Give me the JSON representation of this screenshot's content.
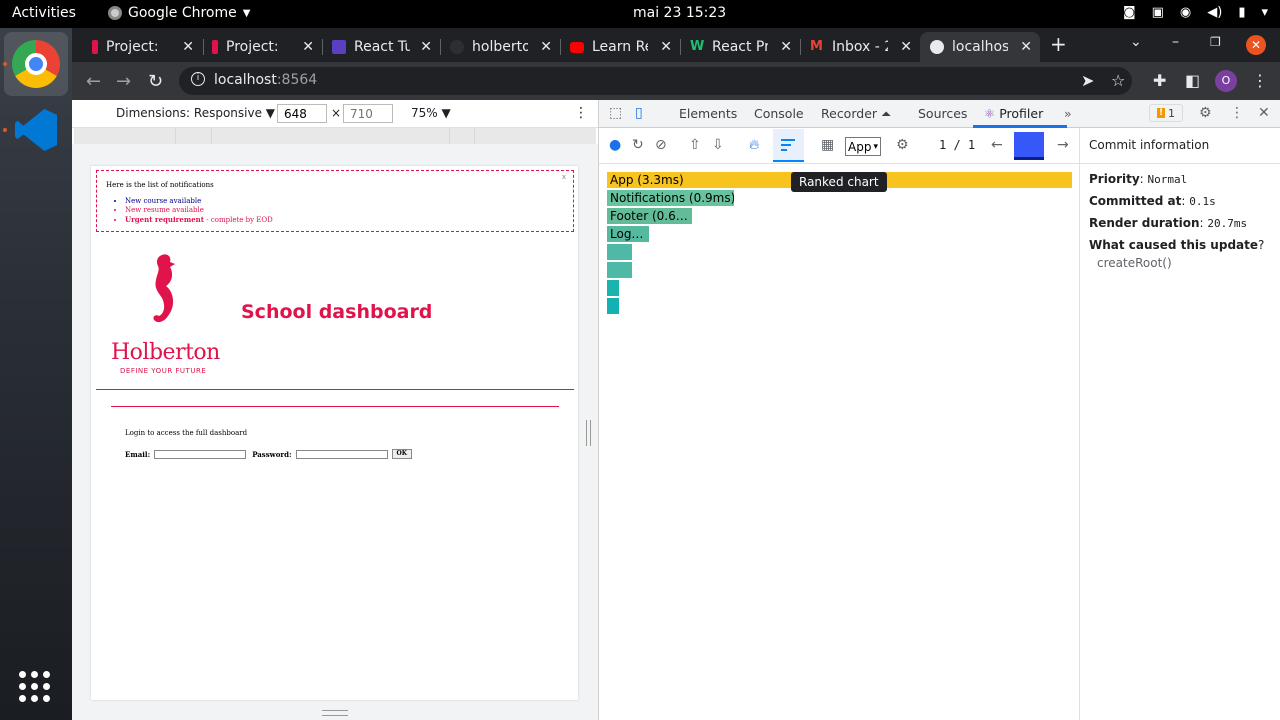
{
  "os": {
    "activities": "Activities",
    "app_name": "Google Chrome",
    "clock": "mai 23  15:23"
  },
  "tabs": [
    {
      "title": "Project:",
      "favicon_color": "#e0134b"
    },
    {
      "title": "Project:",
      "favicon_color": "#e0134b"
    },
    {
      "title": "React Tu",
      "favicon_color": "#5a3fc0"
    },
    {
      "title": "holberto",
      "favicon_color": "#202124"
    },
    {
      "title": "Learn Re",
      "favicon_color": "#ff0000"
    },
    {
      "title": "React Pr",
      "favicon_color": "#1dbf73"
    },
    {
      "title": "Inbox - 2",
      "favicon_color": "#ea4335"
    },
    {
      "title": "localhos",
      "favicon_color": "#e8eaed"
    }
  ],
  "address": {
    "host": "localhost",
    "port": ":8564"
  },
  "profile_initial": "O",
  "device_toolbar": {
    "dimensions_label": "Dimensions: Responsive ▼",
    "width": "648",
    "height_placeholder": "710",
    "times": "×",
    "zoom": "75% ▼"
  },
  "page": {
    "notifications_title": "Here is the list of notifications",
    "close_x": "x",
    "items": [
      {
        "text": "New course available",
        "type": "default"
      },
      {
        "text": "New resume available",
        "type": "urgent"
      },
      {
        "strong": "Urgent requirement",
        "rest": " - complete by EOD",
        "type": "urgent"
      }
    ],
    "logo_brand": "Holberton",
    "logo_tagline": "DEFINE YOUR FUTURE",
    "title": "School dashboard",
    "login_text": "Login to access the full dashboard",
    "email_label": "Email:",
    "password_label": "Password:",
    "ok_label": "OK"
  },
  "devtools": {
    "tabs": [
      "Elements",
      "Console",
      "Recorder ⏶",
      "Sources",
      "Profiler"
    ],
    "active_tab": "Profiler",
    "more_tabs": "»",
    "warnings_count": "1",
    "root_select": "App",
    "commit_counter": "1 / 1",
    "tooltip": "Ranked chart",
    "ranked_bars": [
      {
        "label": "App (3.3ms)",
        "value": 3.3,
        "color": "#f7c31f"
      },
      {
        "label": "Notifications (0.9ms)",
        "value": 0.9,
        "color": "#67c39e"
      },
      {
        "label": "Footer (0.6…",
        "value": 0.6,
        "color": "#62bc98"
      },
      {
        "label": "Log…",
        "value": 0.3,
        "color": "#55b9a0"
      },
      {
        "label": "",
        "value": 0.18,
        "color": "#4fb9a8"
      },
      {
        "label": "",
        "value": 0.18,
        "color": "#4fb9a8"
      },
      {
        "label": "",
        "value": 0.08,
        "color": "#1ab3ae"
      },
      {
        "label": "",
        "value": 0.08,
        "color": "#14b1b2"
      }
    ],
    "commit_info": {
      "header": "Commit information",
      "priority_label": "Priority",
      "priority_value": "Normal",
      "committed_label": "Committed at",
      "committed_value": "0.1s",
      "render_label": "Render duration",
      "render_value": "20.7ms",
      "cause_label": "What caused this update",
      "cause_value": "createRoot()"
    }
  }
}
